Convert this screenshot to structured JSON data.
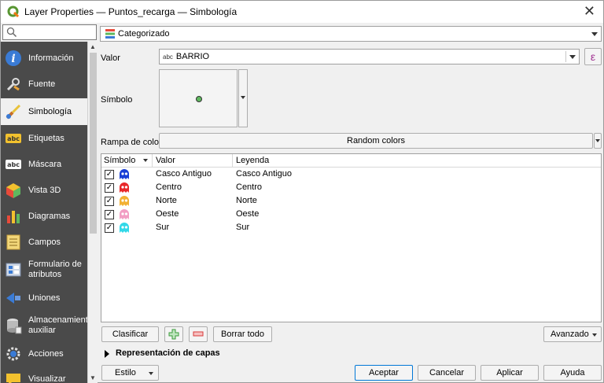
{
  "window": {
    "title": "Layer Properties — Puntos_recarga — Simbología",
    "close_glyph": "✕"
  },
  "sidebar": {
    "search_placeholder": "",
    "items": [
      {
        "label": "Información",
        "icon": "info-icon"
      },
      {
        "label": "Fuente",
        "icon": "wrench-icon"
      },
      {
        "label": "Simbología",
        "icon": "paintbrush-icon",
        "active": true
      },
      {
        "label": "Etiquetas",
        "icon": "labels-abc-icon"
      },
      {
        "label": "Máscara",
        "icon": "mask-abc-icon"
      },
      {
        "label": "Vista 3D",
        "icon": "cube-icon"
      },
      {
        "label": "Diagramas",
        "icon": "diagram-icon"
      },
      {
        "label": "Campos",
        "icon": "fields-icon"
      },
      {
        "label": "Formulario de atributos",
        "icon": "form-icon"
      },
      {
        "label": "Uniones",
        "icon": "join-icon"
      },
      {
        "label": "Almacenamiento auxiliar",
        "icon": "storage-icon"
      },
      {
        "label": "Acciones",
        "icon": "gear-icon"
      },
      {
        "label": "Visualizar",
        "icon": "speech-icon"
      }
    ]
  },
  "renderer": {
    "type_label": "Categorizado"
  },
  "value_field": {
    "label": "Valor",
    "type_prefix": "abc",
    "value": "BARRIO",
    "expr_glyph": "ε"
  },
  "symbol": {
    "label": "Símbolo"
  },
  "color_ramp": {
    "label": "Rampa de color",
    "value": "Random colors"
  },
  "table": {
    "headers": [
      "Símbolo",
      "Valor",
      "Leyenda"
    ],
    "rows": [
      {
        "value": "Casco Antiguo",
        "legend": "Casco Antiguo",
        "color": "#1a3fd6",
        "checked": true
      },
      {
        "value": "Centro",
        "legend": "Centro",
        "color": "#e8282a",
        "checked": true
      },
      {
        "value": "Norte",
        "legend": "Norte",
        "color": "#f2b134",
        "checked": true
      },
      {
        "value": "Oeste",
        "legend": "Oeste",
        "color": "#f29ec4",
        "checked": true
      },
      {
        "value": "Sur",
        "legend": "Sur",
        "color": "#32d8e8",
        "checked": true
      }
    ],
    "check_glyph": "✓"
  },
  "actions": {
    "classify": "Clasificar",
    "delete_all": "Borrar todo",
    "advanced": "Avanzado"
  },
  "layer_render": {
    "title": "Representación de capas"
  },
  "footer": {
    "style": "Estilo",
    "accept": "Aceptar",
    "cancel": "Cancelar",
    "apply": "Aplicar",
    "help": "Ayuda"
  }
}
